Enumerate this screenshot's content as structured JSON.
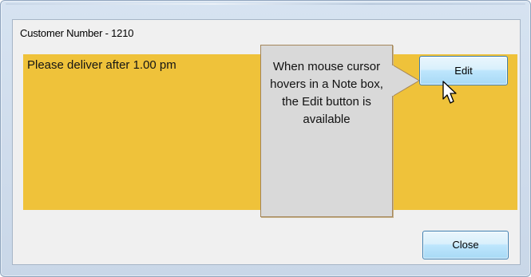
{
  "dialog": {
    "title": "Customer Number - 1210"
  },
  "note": {
    "text": "Please deliver after 1.00 pm",
    "color": "#efc23a"
  },
  "callout": {
    "text": "When mouse cursor hovers in a Note box, the Edit button is available"
  },
  "buttons": {
    "edit_label": "Edit",
    "close_label": "Close"
  },
  "colors": {
    "window_frame": "#cfdcec",
    "button_border": "#3c7fb1",
    "callout_bg": "#d9d9d9"
  },
  "icons": {
    "cursor": "mouse-pointer-icon"
  }
}
